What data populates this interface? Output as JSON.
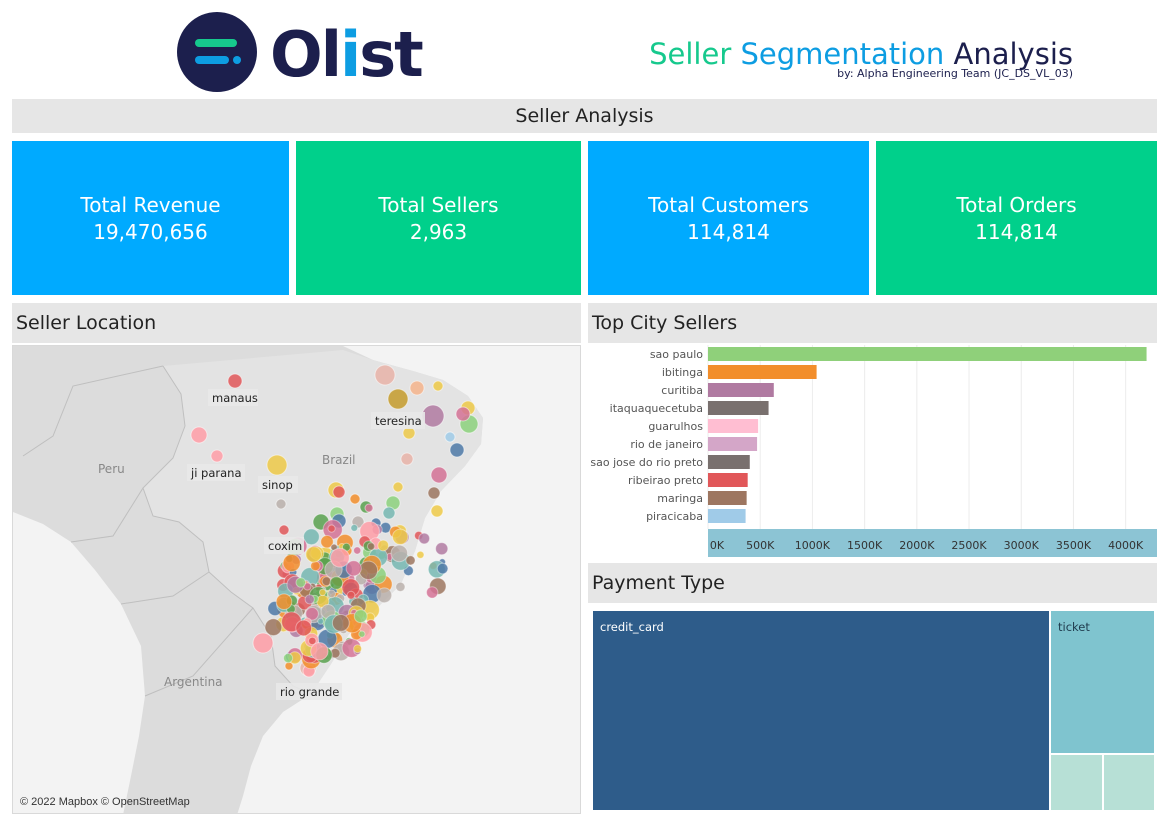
{
  "header": {
    "logo_text": "Olist",
    "title_part1": "Seller",
    "title_part2": "Segmentation",
    "title_part3": "Analysis",
    "subtitle": "by: Alpha Engineering Team (JC_DS_VL_03)",
    "colors": {
      "navy": "#1c1f4d",
      "green": "#16c98d",
      "blue": "#0d9de2"
    }
  },
  "seller_analysis": {
    "title": "Seller Analysis"
  },
  "kpis": [
    {
      "label": "Total Revenue",
      "value": "19,470,656",
      "color": "#00aaff"
    },
    {
      "label": "Total Sellers",
      "value": "2,963",
      "color": "#00d08b"
    },
    {
      "label": "Total Customers",
      "value": "114,814",
      "color": "#00aaff"
    },
    {
      "label": "Total Orders",
      "value": "114,814",
      "color": "#00d08b"
    }
  ],
  "seller_location": {
    "title": "Seller Location",
    "city_labels": [
      "manaus",
      "teresina",
      "ji parana",
      "sinop",
      "coxim",
      "rio grande"
    ],
    "country_labels": [
      "Peru",
      "Brazil",
      "Argentina"
    ],
    "attribution": "© 2022 Mapbox © OpenStreetMap"
  },
  "top_city_sellers": {
    "title": "Top City Sellers",
    "chart_data": {
      "type": "bar",
      "orientation": "horizontal",
      "categories": [
        "sao paulo",
        "ibitinga",
        "curitiba",
        "itaquaquecetuba",
        "guarulhos",
        "rio de janeiro",
        "sao jose do rio preto",
        "ribeirao preto",
        "maringa",
        "piracicaba"
      ],
      "values": [
        4200,
        1040,
        630,
        580,
        480,
        470,
        400,
        380,
        370,
        360
      ],
      "colors": [
        "#8fd07a",
        "#f28e2b",
        "#b07aa1",
        "#79706e",
        "#ffbed2",
        "#d4a6c8",
        "#79706e",
        "#e15759",
        "#9d7660",
        "#a0cbe8"
      ],
      "xticks": [
        "0K",
        "500K",
        "1000K",
        "1500K",
        "2000K",
        "2500K",
        "3000K",
        "3500K",
        "4000K"
      ],
      "xlim": [
        0,
        4300
      ],
      "axis_color": "#8cc4d4",
      "grid": true
    }
  },
  "payment_type": {
    "title": "Payment Type",
    "chart_data": {
      "type": "treemap",
      "labels": [
        "credit_card",
        "ticket",
        "",
        ""
      ],
      "values": [
        76795,
        19784,
        1529,
        1520
      ],
      "colors": [
        "#2e5c8a",
        "#7fc4cf",
        "#b7e0d6",
        "#b7e0d6"
      ]
    }
  }
}
